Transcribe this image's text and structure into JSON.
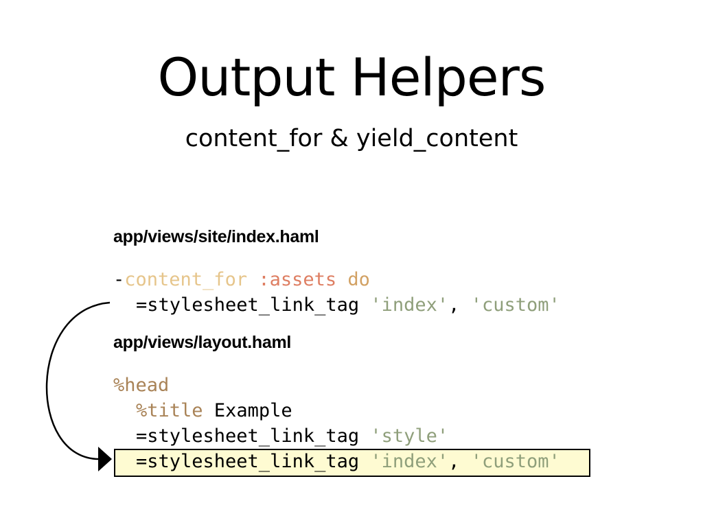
{
  "slide": {
    "title": "Output Helpers",
    "subtitle": "content_for & yield_content"
  },
  "file1": {
    "label": "app/views/site/index.haml",
    "line1": {
      "dash": "-",
      "method": "content_for",
      "symbol": ":assets",
      "keyword": "do"
    },
    "line2": {
      "call": "=stylesheet_link_tag",
      "arg1": "'index'",
      "comma": ",",
      "arg2": "'custom'"
    }
  },
  "file2": {
    "label": "app/views/layout.haml",
    "line1": {
      "tag": "%head"
    },
    "line2": {
      "tag": "%title",
      "text": "Example"
    },
    "line3": {
      "call": "=stylesheet_link_tag",
      "arg1": "'style'"
    },
    "line4": {
      "call": "=stylesheet_link_tag",
      "arg1": "'index'",
      "comma": ",",
      "arg2": "'custom'"
    }
  },
  "colors": {
    "method": "#e6c58b",
    "symbol": "#de7e62",
    "keyword": "#d2a163",
    "string": "#8f9f7b",
    "tag": "#a98357",
    "highlight": "#fefbd2"
  },
  "icons": [
    "curved-arrow-icon"
  ]
}
